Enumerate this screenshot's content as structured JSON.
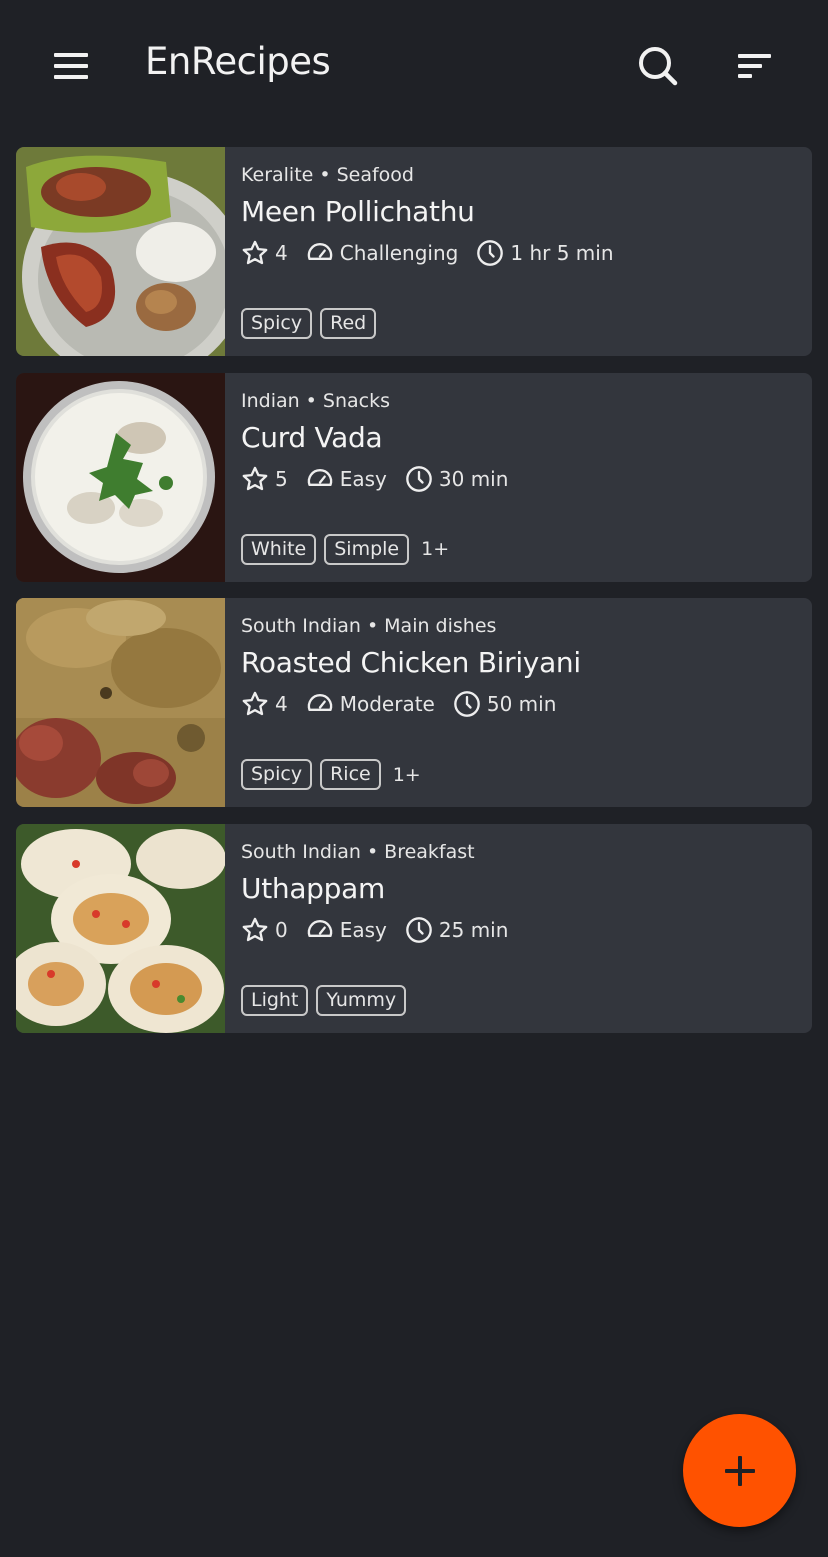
{
  "appbar": {
    "title": "EnRecipes",
    "menu_icon": "menu-icon",
    "search_icon": "search-icon",
    "sort_icon": "sort-icon"
  },
  "recipes": [
    {
      "cuisine": "Keralite",
      "category": "Seafood",
      "title": "Meen Pollichathu",
      "rating": "4",
      "difficulty": "Challenging",
      "time": "1 hr 5 min",
      "tags": [
        "Spicy",
        "Red"
      ],
      "more": ""
    },
    {
      "cuisine": "Indian",
      "category": "Snacks",
      "title": "Curd Vada",
      "rating": "5",
      "difficulty": "Easy",
      "time": "30 min",
      "tags": [
        "White",
        "Simple"
      ],
      "more": "1+"
    },
    {
      "cuisine": "South Indian",
      "category": "Main dishes",
      "title": "Roasted Chicken Biriyani",
      "rating": "4",
      "difficulty": "Moderate",
      "time": "50 min",
      "tags": [
        "Spicy",
        "Rice"
      ],
      "more": "1+"
    },
    {
      "cuisine": "South Indian",
      "category": "Breakfast",
      "title": "Uthappam",
      "rating": "0",
      "difficulty": "Easy",
      "time": "25 min",
      "tags": [
        "Light",
        "Yummy"
      ],
      "more": ""
    }
  ],
  "fab": {
    "icon": "plus-icon"
  },
  "colors": {
    "background": "#1f2126",
    "card": "#33363d",
    "accent": "#ff5200"
  }
}
